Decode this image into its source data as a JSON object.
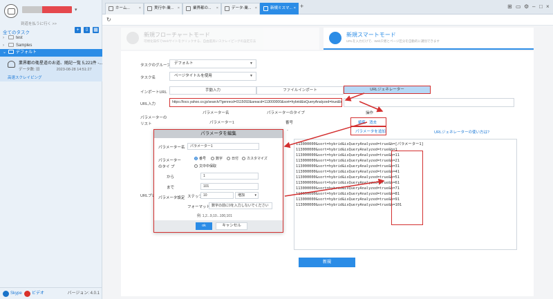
{
  "sidebar": {
    "subtitle": "到道を払うに行く >>",
    "all_tasks": "全てのタスク",
    "tree": [
      {
        "label": "test",
        "caret": "›"
      },
      {
        "label": "Samples",
        "caret": "›"
      },
      {
        "label": "デフォルト",
        "caret": "⌄"
      }
    ],
    "task": {
      "title": "業界都の衛星道のお道、随記一覧 5,221件 -...",
      "meta_left": "データ数: 旧",
      "meta_right": "2023-08-28 14:51:27",
      "mode": "高速スクレイピング"
    },
    "footer": {
      "skype": "Skype",
      "video": "ビデオ",
      "version": "バージョン: 4.0.1"
    }
  },
  "tabs": [
    {
      "label": "ホーム..."
    },
    {
      "label": "実行中-業..."
    },
    {
      "label": "業界都の..."
    },
    {
      "label": "データ-業..."
    },
    {
      "label": "新規ミスマ..."
    }
  ],
  "modes": {
    "flow": {
      "title": "新規フローチャートモード",
      "desc": "可視化操作でWebサイトをクリックする、自由度高いスクレイピングの設定方法"
    },
    "smart": {
      "title": "新規スマートモード",
      "desc": "URLを入力だけで、Web只者とページ区分を自動的に識別できます"
    }
  },
  "form": {
    "group_label": "タスクのグループ",
    "group_value": "デフォルト",
    "name_label": "タスク名",
    "name_value": "ページタイトルを使用",
    "import_label": "インポートURL",
    "import_options": [
      "手動入力",
      "ファイルインポート",
      "URLジェネレーター"
    ],
    "url_label": "URL入力",
    "url_value": "https://loco.yahoo.co.jp/search/?genrecd=0115092&areacd=113000000&sort=hybrid&isQueryAnalyzed=true&b=",
    "param_list_label": "パラメーターのリスト",
    "param_headers": [
      "パラメーター名",
      "パラメーターのタイプ",
      "操作"
    ],
    "param_row": {
      "name": "パラメーター1",
      "type": "番号",
      "edit": "編集",
      "delete": "消去"
    },
    "param_row2_type": "-",
    "add_param": "パラメータを追加",
    "generator_help": "URLジェネレーターの使い方は?",
    "preview_label": "URLプレ",
    "url_list": [
      "113000000&sort=hybrid&isQueryAnalyzed=true&b=[パラメーター1]",
      "113000000&sort=hybrid&isQueryAnalyzed=true&b=1",
      "113000000&sort=hybrid&isQueryAnalyzed=true&b=11",
      "113000000&sort=hybrid&isQueryAnalyzed=true&b=21",
      "113000000&sort=hybrid&isQueryAnalyzed=true&b=31",
      "113000000&sort=hybrid&isQueryAnalyzed=true&b=41",
      "113000000&sort=hybrid&isQueryAnalyzed=true&b=51",
      "113000000&sort=hybrid&isQueryAnalyzed=true&b=61",
      "113000000&sort=hybrid&isQueryAnalyzed=true&b=71",
      "113000000&sort=hybrid&isQueryAnalyzed=true&b=81",
      "113000000&sort=hybrid&isQueryAnalyzed=true&b=91",
      "113000000&sort=hybrid&isQueryAnalyzed=true&b=101"
    ],
    "new_button": "新規"
  },
  "dialog": {
    "title": "パラメータを編集",
    "name_label": "パラメーター名",
    "name_value": "パラメーター1",
    "type_label": "パラメーターのタイ プ",
    "types": [
      "番号",
      "数字",
      "日付",
      "カスタマイズ",
      "文中中保取"
    ],
    "selected_type": "番号",
    "settings_label": "パラメータ設定",
    "from_label": "から",
    "from_value": "1",
    "to_label": "まで",
    "to_value": "101",
    "step_label": "ステップ",
    "step_value": "10",
    "step_dir": "増加",
    "format_label": "フォーマット",
    "format_value": "数字の前に0を入力しないでください",
    "example": "例: 1,2...9,10...100,101",
    "ok": "ok",
    "cancel": "キャンセル"
  },
  "colors": {
    "accent": "#2b8ce6",
    "highlight": "#d32f2f"
  }
}
